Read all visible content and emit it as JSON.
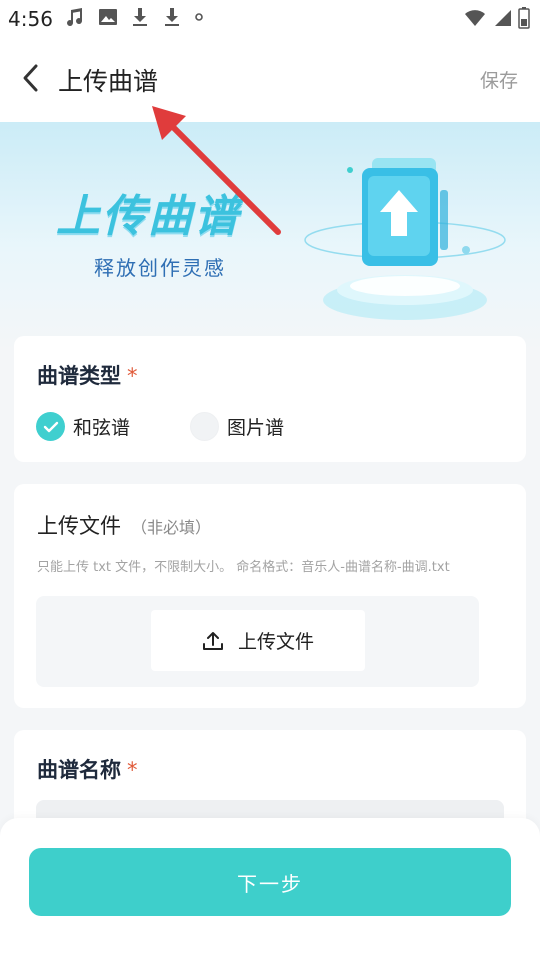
{
  "status_bar": {
    "time": "4:56",
    "left_icons": [
      "music-icon",
      "image-icon",
      "download-icon",
      "download-icon",
      "dot-icon"
    ],
    "right_icons": [
      "wifi-icon",
      "signal-icon",
      "battery-icon"
    ]
  },
  "header": {
    "title": "上传曲谱",
    "save_label": "保存",
    "back_icon": "chevron-left-icon"
  },
  "banner": {
    "title": "上传曲谱",
    "subtitle": "释放创作灵感"
  },
  "score_type": {
    "label": "曲谱类型",
    "required_mark": "*",
    "options": [
      {
        "label": "和弦谱",
        "checked": true
      },
      {
        "label": "图片谱",
        "checked": false
      }
    ]
  },
  "upload": {
    "label": "上传文件",
    "optional_note": "（非必填）",
    "hint": "只能上传 txt 文件，不限制大小。 命名格式：音乐人-曲谱名称-曲调.txt",
    "button_label": "上传文件",
    "button_icon": "upload-icon"
  },
  "score_name": {
    "label": "曲谱名称",
    "required_mark": "*",
    "value": ""
  },
  "footer": {
    "next_label": "下一步"
  },
  "colors": {
    "accent": "#3ecfcb",
    "required": "#e05a3a",
    "annotation_arrow": "#e03c3c"
  }
}
